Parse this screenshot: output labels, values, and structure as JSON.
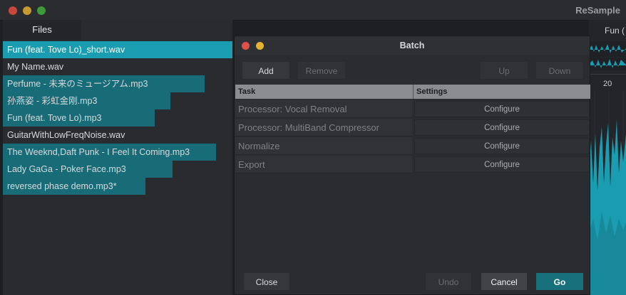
{
  "window": {
    "title": "ReSample",
    "traffic_colors": {
      "close": "#c9463d",
      "minimize": "#c59a31",
      "zoom": "#3f9b3a"
    }
  },
  "files_panel": {
    "tab_label": "Files",
    "files": [
      {
        "name": "Fun (feat. Tove Lo)_short.wav",
        "selected": true,
        "progress": 1.0
      },
      {
        "name": "My Name.wav",
        "selected": false,
        "progress": 0
      },
      {
        "name": "Perfume - 未来のミュージアム.mp3",
        "selected": false,
        "progress": 0.88
      },
      {
        "name": "孙燕姿 - 彩虹金刚.mp3",
        "selected": false,
        "progress": 0.73
      },
      {
        "name": "Fun (feat. Tove Lo).mp3",
        "selected": false,
        "progress": 0.66
      },
      {
        "name": "GuitarWithLowFreqNoise.wav",
        "selected": false,
        "progress": 0
      },
      {
        "name": "The Weeknd,Daft Punk - I Feel It Coming.mp3",
        "selected": false,
        "progress": 0.93
      },
      {
        "name": "Lady GaGa - Poker Face.mp3",
        "selected": false,
        "progress": 0.74
      },
      {
        "name": "reversed phase demo.mp3*",
        "selected": false,
        "progress": 0.62
      }
    ]
  },
  "waveform": {
    "title": "Fun (",
    "ruler_label": "20",
    "accent": "#1a9db0"
  },
  "batch_dialog": {
    "title": "Batch",
    "traffic_colors": {
      "close": "#e0504a",
      "minimize": "#e3b233"
    },
    "toolbar": {
      "add": "Add",
      "remove": "Remove",
      "up": "Up",
      "down": "Down"
    },
    "columns": {
      "task": "Task",
      "settings": "Settings"
    },
    "tasks": [
      {
        "task": "Processor: Vocal Removal",
        "settings": "Configure"
      },
      {
        "task": "Processor: MultiBand Compressor",
        "settings": "Configure"
      },
      {
        "task": "Normalize",
        "settings": "Configure"
      },
      {
        "task": "Export",
        "settings": "Configure"
      }
    ],
    "footer": {
      "close": "Close",
      "undo": "Undo",
      "cancel": "Cancel",
      "go": "Go"
    }
  }
}
